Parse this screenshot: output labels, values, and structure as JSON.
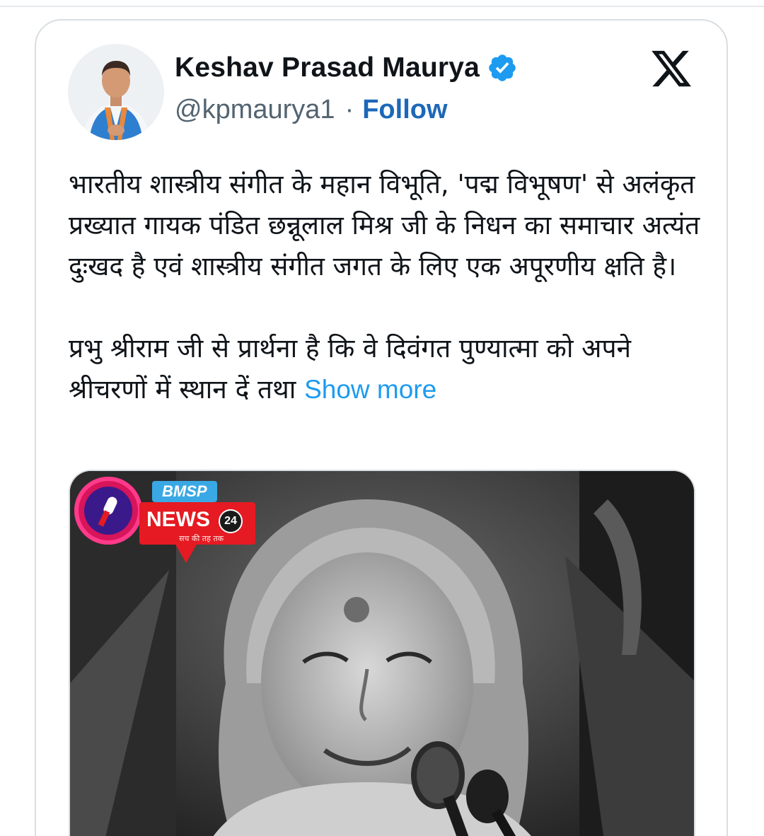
{
  "author": {
    "display_name": "Keshav Prasad Maurya",
    "handle": "@kpmaurya1",
    "separator": "·",
    "follow_label": "Follow",
    "verified": true
  },
  "tweet": {
    "paragraph_1": "भारतीय शास्त्रीय संगीत के महान विभूति, 'पद्म विभूषण' से अलंकृत प्रख्यात गायक पंडित छन्नूलाल मिश्र जी के निधन का समाचार अत्यंत दुःखद है एवं शास्त्रीय संगीत जगत के लिए एक अपूरणीय क्षति है।",
    "paragraph_2": "प्रभु श्रीराम जी से प्रार्थना है कि वे दिवंगत पुण्यात्मा को अपने श्रीचरणों में स्थान दें तथा",
    "show_more_label": "Show more"
  },
  "media": {
    "brand_top": "BMSP",
    "brand_main": "NEWS",
    "brand_number": "24",
    "brand_tagline": "सच की तह तक"
  },
  "colors": {
    "link_blue": "#1d9bf0",
    "follow_blue": "#1d68b8",
    "verified_blue": "#1d9bf0",
    "text_primary": "#0f1419",
    "text_secondary": "#536471"
  },
  "icons": {
    "verified": "verified-badge-icon",
    "platform": "x-logo-icon"
  }
}
